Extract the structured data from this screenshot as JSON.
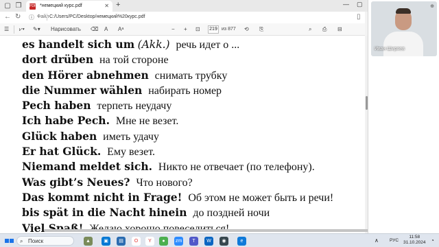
{
  "browser": {
    "tab_title": "*немецкий курс.pdf",
    "new_tab_icon": "+",
    "address_label": "Файл",
    "url": "C:/Users/PC/Desktop/немецкий%20курс.pdf"
  },
  "pdf_toolbar": {
    "draw_label": "Нарисовать",
    "zoom_out": "−",
    "zoom_in": "+",
    "current_page": "219",
    "page_total": "из 877"
  },
  "document": {
    "lines": [
      {
        "de": "es handelt sich um",
        "de_italic": "(Akk.)",
        "ru": "речь идет о ..."
      },
      {
        "de": "dort drüben",
        "de_italic": "",
        "ru": "на той стороне"
      },
      {
        "de": "den Hörer abnehmen",
        "de_italic": "",
        "ru": "снимать трубку"
      },
      {
        "de": "die Nummer wählen",
        "de_italic": "",
        "ru": "набирать номер"
      },
      {
        "de": "Pech haben",
        "de_italic": "",
        "ru": "терпеть неудачу"
      },
      {
        "de": "Ich habe Pech.",
        "de_italic": "",
        "ru": "Мне не везет."
      },
      {
        "de": "Glück haben",
        "de_italic": "",
        "ru": "иметь удачу"
      },
      {
        "de": "Er hat Glück.",
        "de_italic": "",
        "ru": "Ему везет."
      },
      {
        "de": "Niemand meldet sich.",
        "de_italic": "",
        "ru": "Никто не отвечает (по телефону)."
      },
      {
        "de": "Was gibt’s Neues?",
        "de_italic": "",
        "ru": "Что нового?"
      },
      {
        "de": "Das kommt nicht in Frage!",
        "de_italic": "",
        "ru": "Об этом не может быть и речи!"
      },
      {
        "de": "bis spät in die Nacht hinein",
        "de_italic": "",
        "ru": "до поздней ночи"
      },
      {
        "de": "Viel Spaß!",
        "de_italic": "",
        "ru": "Желаю хорошо повеселиться!"
      }
    ]
  },
  "video": {
    "participant_name": "Иван Ширяев"
  },
  "taskbar": {
    "search_placeholder": "Поиск",
    "language": "РУС",
    "time": "11:58",
    "date": "31.10.2024"
  },
  "colors": {
    "accent": "#1a73e8",
    "pdf_red": "#c62828"
  }
}
